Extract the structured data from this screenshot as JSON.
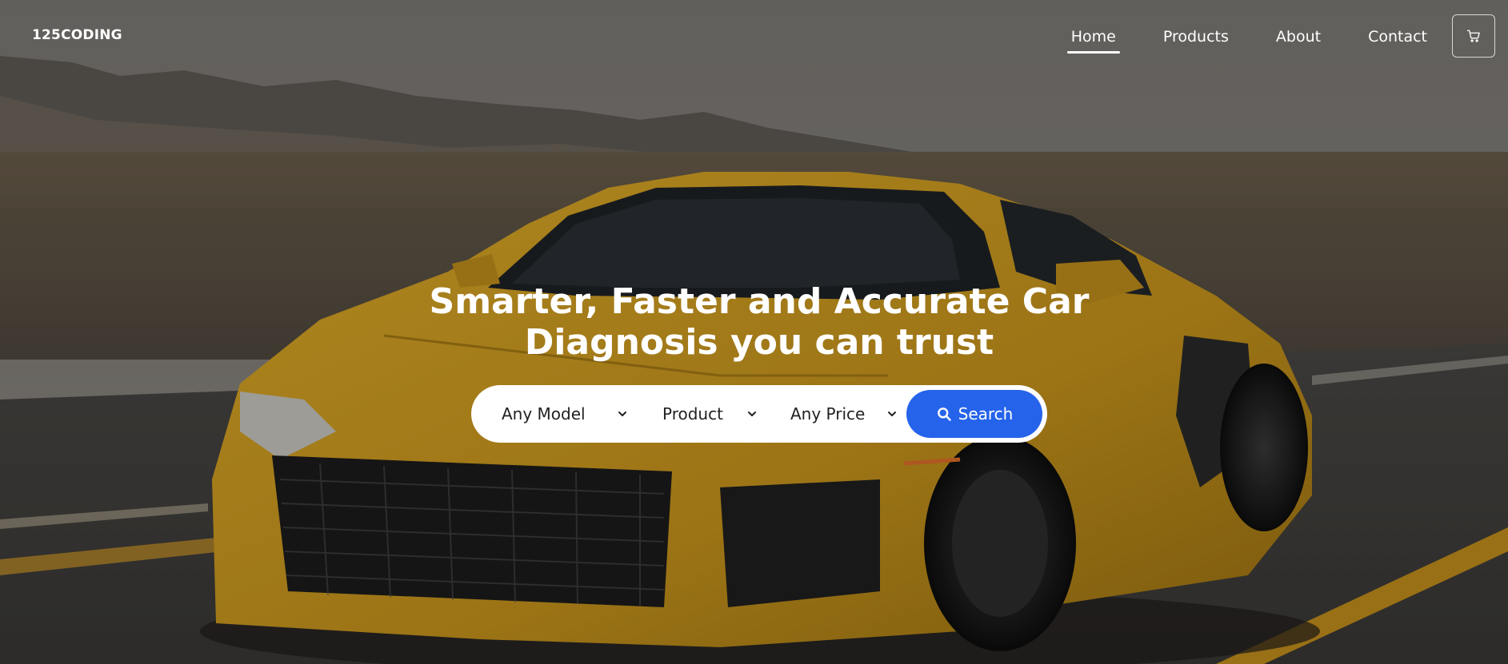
{
  "brand": {
    "logo_text": "125CODING"
  },
  "nav": {
    "items": [
      {
        "label": "Home",
        "active": true
      },
      {
        "label": "Products",
        "active": false
      },
      {
        "label": "About",
        "active": false
      },
      {
        "label": "Contact",
        "active": false
      }
    ],
    "cart_icon": "cart-icon"
  },
  "hero": {
    "headline_line1": "Smarter, Faster and Accurate Car",
    "headline_line2": "Diagnosis you can trust",
    "background_subject": "yellow-sports-car-on-desert-road"
  },
  "search": {
    "model_select": "Any Model",
    "product_select": "Product",
    "price_select": "Any Price",
    "button_label": "Search",
    "button_icon": "search-icon"
  },
  "colors": {
    "accent": "#2563eb",
    "car_body": "#d9a621",
    "text": "#ffffff"
  }
}
